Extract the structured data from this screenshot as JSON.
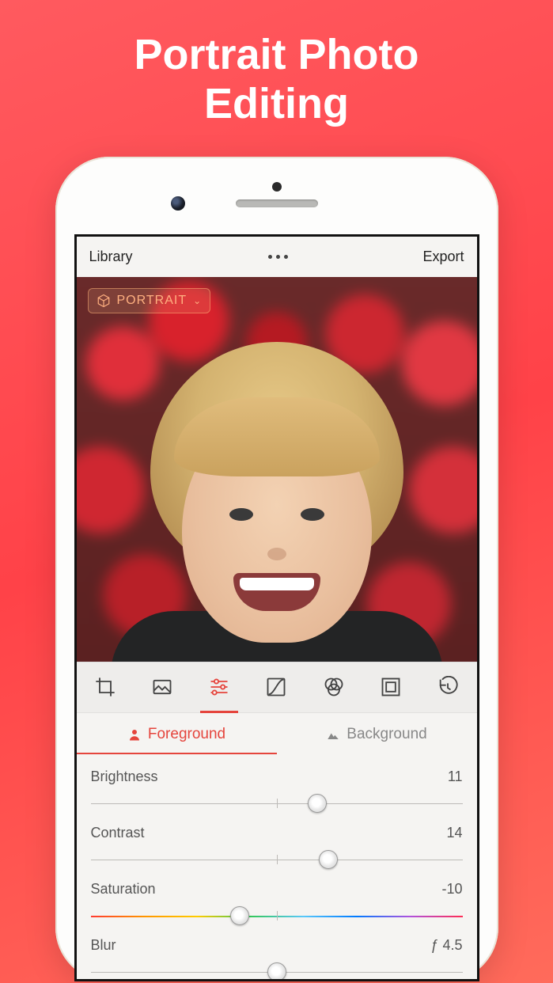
{
  "hero": {
    "title_line1": "Portrait Photo",
    "title_line2": "Editing"
  },
  "nav": {
    "left": "Library",
    "right": "Export"
  },
  "mode_badge": {
    "label": "PORTRAIT"
  },
  "toolbar": {
    "items": [
      {
        "name": "crop-icon"
      },
      {
        "name": "image-adjust-icon"
      },
      {
        "name": "sliders-icon",
        "active": true
      },
      {
        "name": "curves-icon"
      },
      {
        "name": "filters-icon"
      },
      {
        "name": "frame-icon"
      },
      {
        "name": "history-icon"
      }
    ]
  },
  "tabs": {
    "foreground": "Foreground",
    "background": "Background"
  },
  "sliders": {
    "brightness": {
      "label": "Brightness",
      "value": "11",
      "pos": 61
    },
    "contrast": {
      "label": "Contrast",
      "value": "14",
      "pos": 64
    },
    "saturation": {
      "label": "Saturation",
      "value": "-10",
      "pos": 40
    },
    "blur": {
      "label": "Blur",
      "value": "ƒ 4.5",
      "pos": 50
    }
  }
}
